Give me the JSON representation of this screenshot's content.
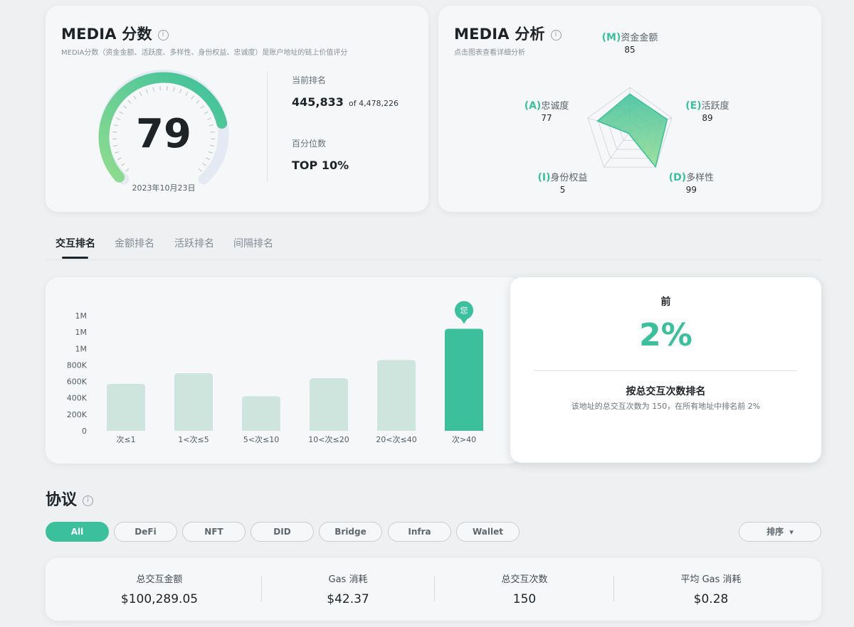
{
  "score_card": {
    "title": "MEDIA 分数",
    "info_icon": "i",
    "subtitle": "MEDIA分数（资金金额、活跃度、多样性、身份权益、忠诚度）是账户地址的链上价值评分",
    "score": "79",
    "date": "2023年10月23日",
    "score_fraction": 0.79,
    "rank_label": "当前排名",
    "rank_value": "445,833",
    "rank_of": "of 4,478,226",
    "percentile_label": "百分位数",
    "percentile_value": "TOP 10%",
    "gauge_colors": [
      "#8fdc8f",
      "#3cbf9c"
    ]
  },
  "analysis_card": {
    "title": "MEDIA 分析",
    "info_icon": "i",
    "subtitle": "点击图表查看详细分析",
    "axes": [
      {
        "code": "(M)",
        "name": "资金金额",
        "value": "85",
        "score": 85
      },
      {
        "code": "(E)",
        "name": "活跃度",
        "value": "89",
        "score": 89
      },
      {
        "code": "(D)",
        "name": "多样性",
        "value": "99",
        "score": 99
      },
      {
        "code": "(I)",
        "name": "身份权益",
        "value": "5",
        "score": 5
      },
      {
        "code": "(A)",
        "name": "忠诚度",
        "value": "77",
        "score": 77
      }
    ],
    "accent": "#3cbf9c"
  },
  "tabs": [
    "交互排名",
    "金额排名",
    "活跃排名",
    "间隔排名"
  ],
  "chart_data": {
    "type": "bar",
    "categories": [
      "次≤1",
      "1<次≤5",
      "5<次≤10",
      "10<次≤20",
      "20<次≤40",
      "次>40"
    ],
    "values": [
      570000,
      700000,
      420000,
      640000,
      860000,
      1240000
    ],
    "y_ticks": [
      "0",
      "200K",
      "400K",
      "600K",
      "800K",
      "1M",
      "1M",
      "1M"
    ],
    "ylim": [
      0,
      1400000
    ],
    "highlight_index": 5,
    "marker_label": "您",
    "colors": {
      "normal": "#cde5dd",
      "highlight": "#3cbf9c"
    }
  },
  "rank_panel": {
    "prefix": "前",
    "percent": "2%",
    "heading": "按总交互次数排名",
    "description": "该地址的总交互次数为 150，在所有地址中排名前 2%"
  },
  "protocols": {
    "title": "协议",
    "info_icon": "i",
    "filters": [
      "All",
      "DeFi",
      "NFT",
      "DID",
      "Bridge",
      "Infra",
      "Wallet"
    ],
    "sort_label": "排序",
    "sort_icon": "▾",
    "stats": [
      {
        "label": "总交互金额",
        "value": "$100,289.05"
      },
      {
        "label": "Gas 消耗",
        "value": "$42.37"
      },
      {
        "label": "总交互次数",
        "value": "150"
      },
      {
        "label": "平均 Gas 消耗",
        "value": "$0.28"
      }
    ]
  }
}
